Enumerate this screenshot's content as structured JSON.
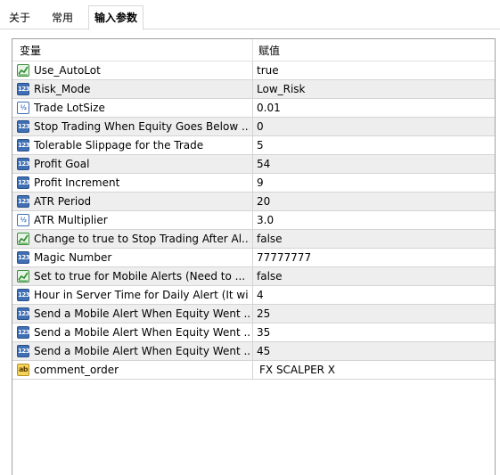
{
  "tabs": [
    {
      "label": "关于"
    },
    {
      "label": "常用"
    },
    {
      "label": "输入参数"
    }
  ],
  "table": {
    "col_variable": "变量",
    "col_value": "赋值",
    "rows": [
      {
        "name": "Use_AutoLot",
        "value": "true",
        "type": "bool",
        "icon": "bool-icon"
      },
      {
        "name": "Risk_Mode",
        "value": "Low_Risk",
        "type": "int",
        "icon": "int-icon"
      },
      {
        "name": "Trade LotSize",
        "value": "0.01",
        "type": "double",
        "icon": "double-icon"
      },
      {
        "name": "Stop Trading When Equity Goes Below ...",
        "value": "0",
        "type": "int",
        "icon": "int-icon"
      },
      {
        "name": "Tolerable Slippage for the Trade",
        "value": "5",
        "type": "int",
        "icon": "int-icon"
      },
      {
        "name": "Profit Goal",
        "value": "54",
        "type": "int",
        "icon": "int-icon"
      },
      {
        "name": "Profit Increment",
        "value": "9",
        "type": "int",
        "icon": "int-icon"
      },
      {
        "name": "ATR Period",
        "value": "20",
        "type": "int",
        "icon": "int-icon"
      },
      {
        "name": "ATR Multiplier",
        "value": "3.0",
        "type": "double",
        "icon": "double-icon"
      },
      {
        "name": "Change to true to Stop Trading After Al...",
        "value": "false",
        "type": "bool",
        "icon": "bool-icon"
      },
      {
        "name": "Magic Number",
        "value": "77777777",
        "type": "int",
        "icon": "int-icon"
      },
      {
        "name": "Set to true for Mobile Alerts (Need to ...",
        "value": "false",
        "type": "bool",
        "icon": "bool-icon"
      },
      {
        "name": "Hour in Server Time for Daily Alert (It wi...",
        "value": "4",
        "type": "int",
        "icon": "int-icon"
      },
      {
        "name": "Send a Mobile Alert When Equity Went ...",
        "value": "25",
        "type": "int",
        "icon": "int-icon"
      },
      {
        "name": "Send a Mobile Alert When Equity Went ...",
        "value": "35",
        "type": "int",
        "icon": "int-icon"
      },
      {
        "name": "Send a Mobile Alert When Equity Went ...",
        "value": "45",
        "type": "int",
        "icon": "int-icon"
      },
      {
        "name": "comment_order",
        "value": "FX SCALPER X",
        "type": "string",
        "icon": "string-icon"
      }
    ]
  }
}
